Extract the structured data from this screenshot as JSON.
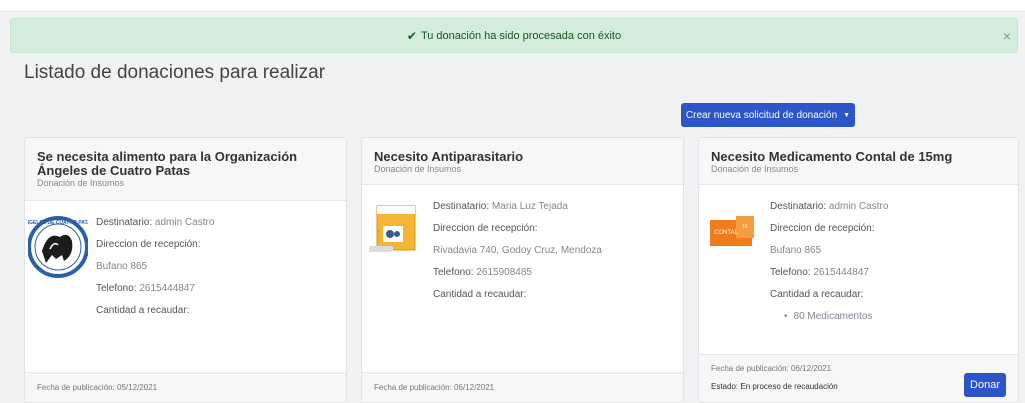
{
  "alert": {
    "icon": "check-icon",
    "message": "Tu donación ha sido procesada con éxito",
    "close": "×"
  },
  "page": {
    "title": "Listado de donaciones para realizar"
  },
  "create_button": {
    "label": "Crear nueva solicitud de donación",
    "caret": "▼"
  },
  "cards": [
    {
      "title": "Se necesita alimento para la Organización Ángeles de Cuatro Patas",
      "subtitle": "Donación de Insumos",
      "image": "angeles-de-cuatro-patas-logo",
      "destinatario_label": "Destinatario:",
      "destinatario": "admin Castro",
      "direccion_label": "Direccion de recepción:",
      "direccion": "Bufano 865",
      "telefono_label": "Telefono:",
      "telefono": "2615444847",
      "cantidad_label": "Cantidad a recaudar:",
      "fecha": "Fecha de publicación: 05/12/2021"
    },
    {
      "title": "Necesito Antiparasitario",
      "subtitle": "Donación de Insumos",
      "image": "antiparasitario-package",
      "destinatario_label": "Destinatario:",
      "destinatario": "Maria Luz Tejada",
      "direccion_label": "Direccion de recepción:",
      "direccion": "Rivadavia 740, Godoy Cruz, Mendoza",
      "telefono_label": "Telefono:",
      "telefono": "2615908485",
      "cantidad_label": "Cantidad a recaudar:",
      "fecha": "Fecha de publicación: 06/12/2021"
    },
    {
      "title": "Necesito Medicamento Contal de 15mg",
      "subtitle": "Donación de Insumos",
      "image": "contal-medicine-box",
      "destinatario_label": "Destinatario:",
      "destinatario": "admin Castro",
      "direccion_label": "Direccion de recepción:",
      "direccion": "Bufano 865",
      "telefono_label": "Telefono:",
      "telefono": "2615444847",
      "cantidad_label": "Cantidad a recaudar:",
      "items": [
        "80 Medicamentos"
      ],
      "fecha": "Fecha de publicación: 06/12/2021",
      "estado": "Estado: En proceso de recaudación",
      "donar_label": "Donar"
    }
  ],
  "colors": {
    "primary": "#2c55c9",
    "alert_bg": "#d4edda",
    "alert_text": "#155724"
  }
}
